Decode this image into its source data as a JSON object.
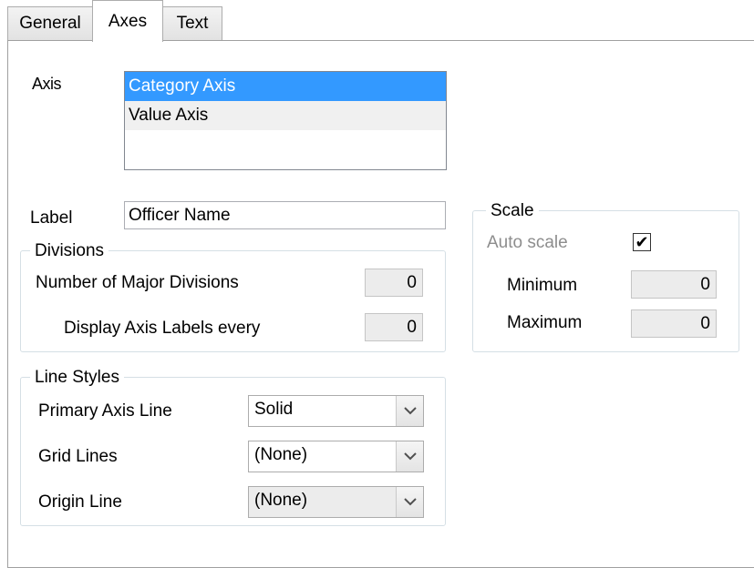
{
  "tabs": [
    {
      "label": "General"
    },
    {
      "label": "Axes"
    },
    {
      "label": "Text"
    }
  ],
  "axis": {
    "label": "Axis",
    "items": [
      {
        "label": "Category Axis",
        "selected": true
      },
      {
        "label": "Value Axis",
        "selected": false
      }
    ]
  },
  "label_field": {
    "label": "Label",
    "value": "Officer Name"
  },
  "divisions": {
    "title": "Divisions",
    "major_label": "Number of Major Divisions",
    "major_value": "0",
    "display_label": "Display Axis Labels every",
    "display_value": "0"
  },
  "scale": {
    "title": "Scale",
    "auto_label": "Auto scale",
    "auto_checked": true,
    "check_glyph": "✔",
    "min_label": "Minimum",
    "min_value": "0",
    "max_label": "Maximum",
    "max_value": "0"
  },
  "line_styles": {
    "title": "Line Styles",
    "primary_label": "Primary Axis Line",
    "primary_value": "Solid",
    "grid_label": "Grid Lines",
    "grid_value": "(None)",
    "origin_label": "Origin Line",
    "origin_value": "(None)"
  },
  "icons": {
    "dropdown": "chevron-down-icon",
    "check": "checkmark-icon"
  },
  "colors": {
    "selection": "#3399ff",
    "disabled_field": "#ececec",
    "group_border": "#d5dfe5"
  }
}
